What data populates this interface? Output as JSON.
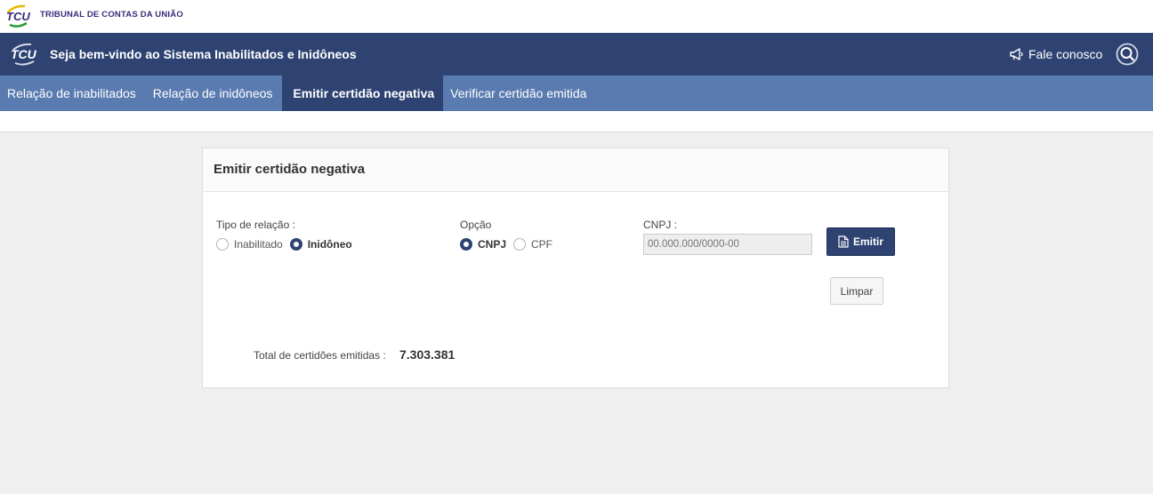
{
  "brand": {
    "logo_text": "TCU",
    "name": "TRIBUNAL DE CONTAS DA UNIÃO"
  },
  "header": {
    "logo_text": "TCU",
    "title": "Seja bem-vindo ao Sistema Inabilitados e Inidôneos",
    "contact_label": "Fale conosco",
    "contact_icon": "megaphone-icon",
    "search_icon": "search-icon"
  },
  "nav": {
    "items": [
      {
        "label": "Relação de inabilitados",
        "active": false
      },
      {
        "label": "Relação de inidôneos",
        "active": false
      },
      {
        "label": "Emitir certidão negativa",
        "active": true
      },
      {
        "label": "Verificar certidão emitida",
        "active": false
      }
    ]
  },
  "form": {
    "title": "Emitir certidão negativa",
    "tipo_label": "Tipo de relação :",
    "tipo_options": [
      {
        "label": "Inabilitado",
        "selected": false
      },
      {
        "label": "Inidôneo",
        "selected": true
      }
    ],
    "opcao_label": "Opção",
    "opcao_options": [
      {
        "label": "CNPJ",
        "selected": true
      },
      {
        "label": "CPF",
        "selected": false
      }
    ],
    "cnpj_label": "CNPJ :",
    "cnpj_placeholder": "00.000.000/0000-00",
    "cnpj_value": "",
    "emitir_label": "Emitir",
    "limpar_label": "Limpar",
    "total_label": "Total de certidões emitidas :",
    "total_value": "7.303.381"
  },
  "colors": {
    "header_bg": "#2e4372",
    "nav_bg": "#5a7bb0",
    "nav_active_bg": "#2e4372",
    "page_bg": "#efefef"
  }
}
